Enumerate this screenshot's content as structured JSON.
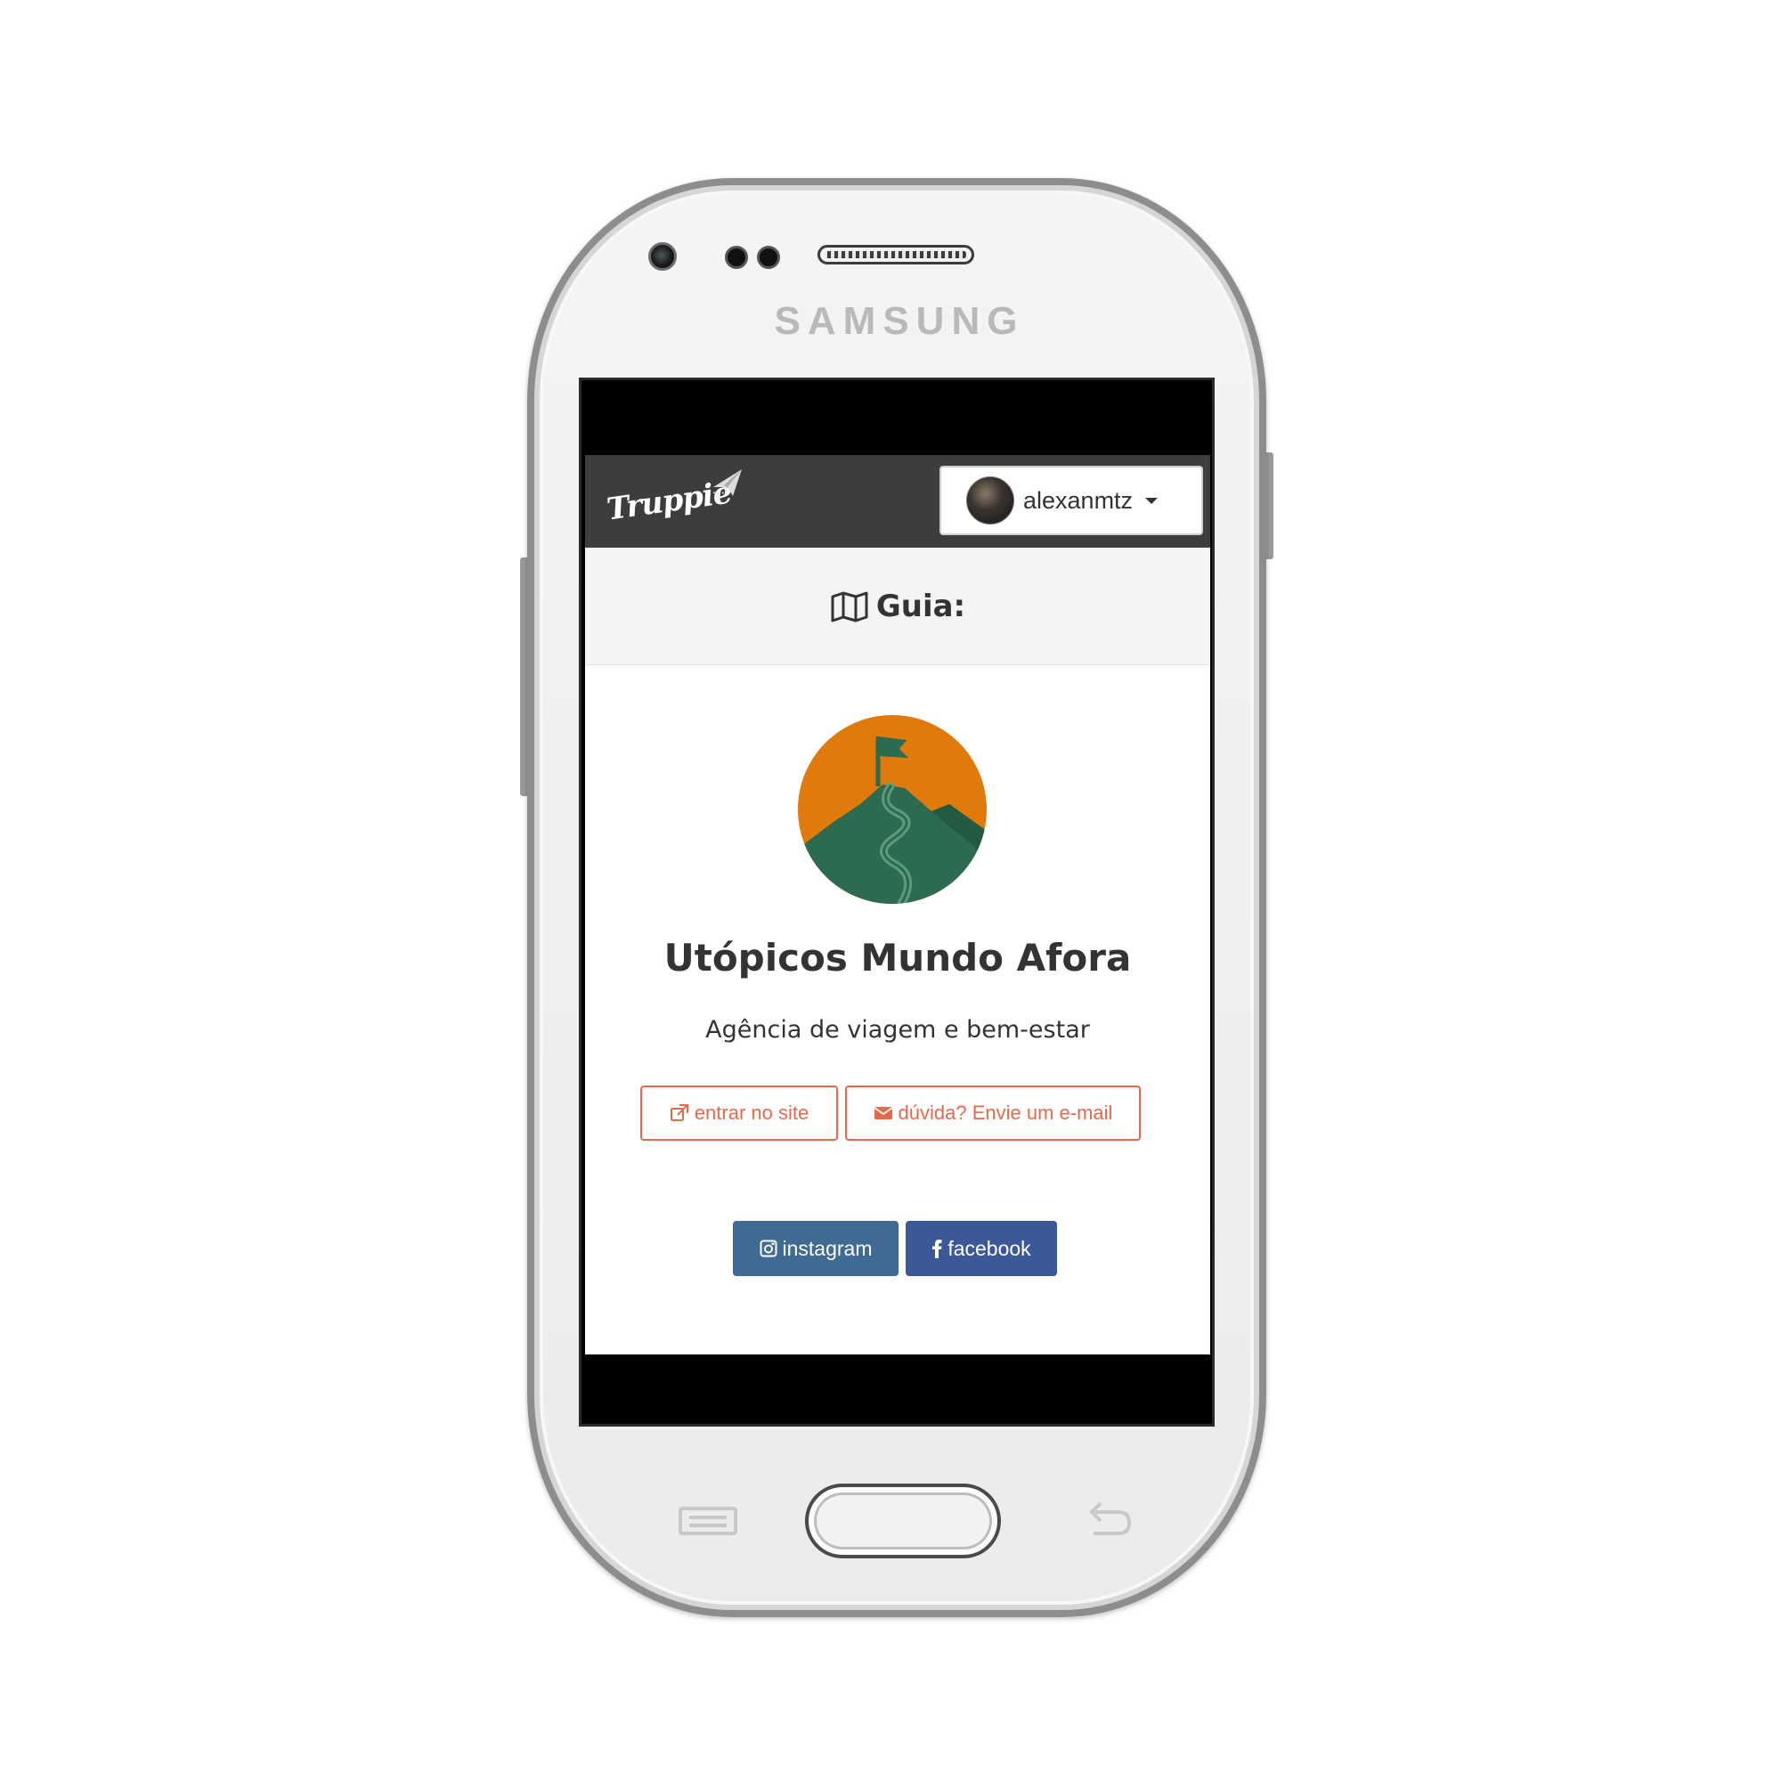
{
  "device": {
    "brand": "SAMSUNG"
  },
  "navbar": {
    "logo_text": "Truppie",
    "username": "alexanmtz"
  },
  "header": {
    "icon": "map-icon",
    "title": "Guia:"
  },
  "organization": {
    "logo": "mountain-flag-logo",
    "logo_colors": {
      "sky": "#e07a0a",
      "mountain": "#2c6b4f",
      "path": "#5e9a7e"
    },
    "name": "Utópicos Mundo Afora",
    "description": "Agência de viagem e bem-estar"
  },
  "actions": {
    "site_label": "entrar no site",
    "site_icon": "external-link-icon",
    "email_label": "dúvida? Envie um e-mail",
    "email_icon": "envelope-icon",
    "accent_color": "#e8694a"
  },
  "social": {
    "instagram_label": "instagram",
    "instagram_color": "#3f6a94",
    "facebook_label": "facebook",
    "facebook_color": "#3b5898"
  }
}
